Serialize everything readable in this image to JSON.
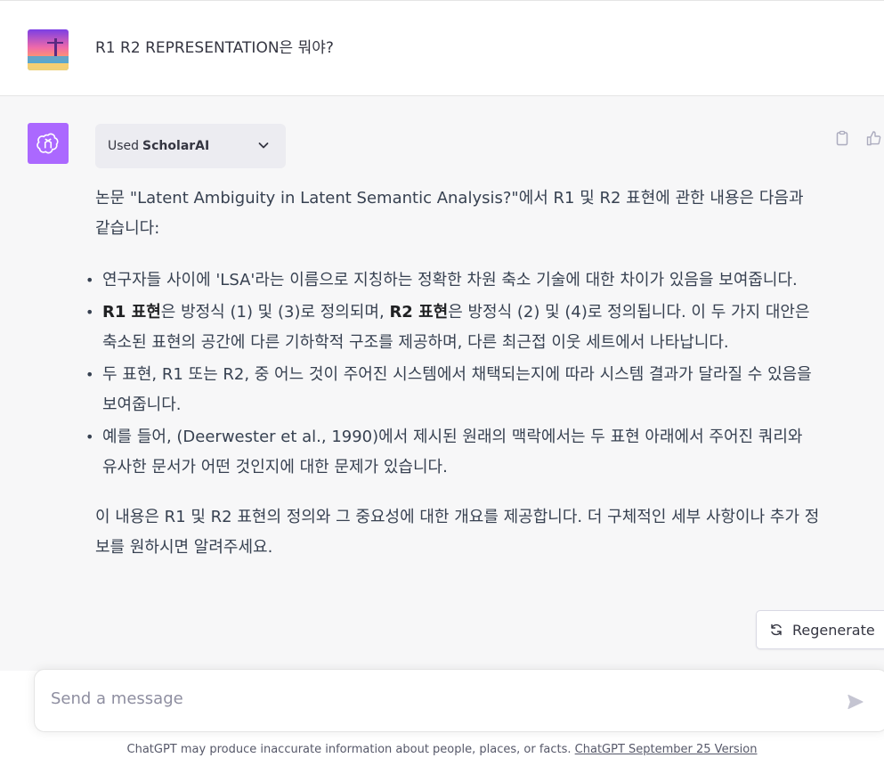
{
  "conversation": {
    "user_message": "R1 R2 REPRESENTATION은 뭐야?",
    "plugin": {
      "used_label": "Used",
      "name": "ScholarAI"
    },
    "answer": {
      "intro": "논문 \"Latent Ambiguity in Latent Semantic Analysis?\"에서 R1 및 R2 표현에 관한 내용은 다음과 같습니다:",
      "bullets": [
        {
          "text": "연구자들 사이에 'LSA'라는 이름으로 지칭하는 정확한 차원 축소 기술에 대한 차이가 있음을 보여줍니다."
        },
        {
          "bold1": "R1 표현",
          "mid1": "은 방정식 (1) 및 (3)로 정의되며, ",
          "bold2": "R2 표현",
          "mid2": "은 방정식 (2) 및 (4)로 정의됩니다. 이 두 가지 대안은 축소된 표현의 공간에 다른 기하학적 구조를 제공하며, 다른 최근접 이웃 세트에서 나타납니다."
        },
        {
          "text": "두 표현, R1 또는 R2, 중 어느 것이 주어진 시스템에서 채택되는지에 따라 시스템 결과가 달라질 수 있음을 보여줍니다."
        },
        {
          "text": "예를 들어, (Deerwester et al., 1990)에서 제시된 원래의 맥락에서는 두 표현 아래에서 주어진 쿼리와 유사한 문서가 어떤 것인지에 대한 문제가 있습니다."
        }
      ],
      "outro": "이 내용은 R1 및 R2 표현의 정의와 그 중요성에 대한 개요를 제공합니다. 더 구체적인 세부 사항이나 추가 정보를 원하시면 알려주세요."
    }
  },
  "actions": {
    "regenerate_label": "Regenerate"
  },
  "composer": {
    "placeholder": "Send a message"
  },
  "footer": {
    "disclaimer": "ChatGPT may produce inaccurate information about people, places, or facts. ",
    "version_link": "ChatGPT September 25 Version"
  },
  "icons": {
    "plugin_chevron": "chevron-down-icon",
    "copy": "clipboard-icon",
    "like": "thumbs-up-icon",
    "regenerate": "refresh-icon",
    "send": "send-icon",
    "bot": "openai-logo-icon"
  },
  "colors": {
    "bot_avatar": "#ab68ff",
    "assistant_bg": "#f7f7f8",
    "pill_bg": "#ececf1"
  }
}
